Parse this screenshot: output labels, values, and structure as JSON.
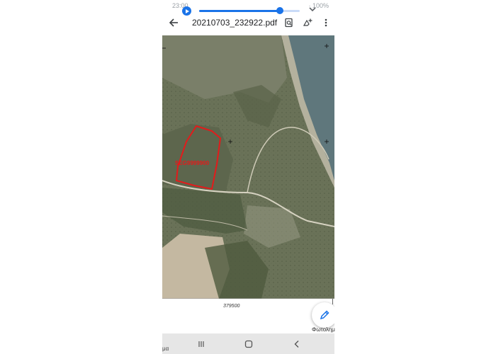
{
  "status": {
    "time": "23:00",
    "right": "· 100%"
  },
  "media": {
    "progress": 0.8
  },
  "toolbar": {
    "filename": "20210703_232922.pdf"
  },
  "map": {
    "parcel_label": "SEG9999900",
    "coord_label": "379500"
  },
  "overflow_text": {
    "left": "μα",
    "right": "Φωτολημ"
  },
  "icons": {
    "play": "play-icon",
    "collapse": "chevron-down-icon",
    "back": "arrow-back-icon",
    "search_doc": "search-document-icon",
    "drive_add": "drive-add-icon",
    "more": "more-vert-icon",
    "edit": "pencil-icon",
    "recent": "recents-icon",
    "home": "home-icon",
    "back_nav": "back-nav-icon"
  },
  "colors": {
    "accent": "#1a73e8",
    "parcel": "#e31b1b"
  }
}
